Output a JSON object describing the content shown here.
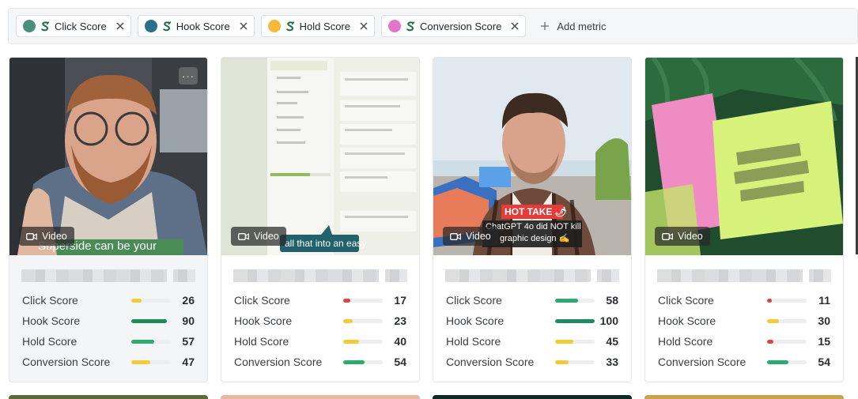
{
  "filters": {
    "chips": [
      {
        "label": "Click Score",
        "color": "#4a8f7a"
      },
      {
        "label": "Hook Score",
        "color": "#2a6f8c"
      },
      {
        "label": "Hold Score",
        "color": "#f5b93b"
      },
      {
        "label": "Conversion Score",
        "color": "#e276c9"
      }
    ],
    "add_label": "Add metric"
  },
  "metric_labels": [
    "Click Score",
    "Hook Score",
    "Hold Score",
    "Conversion Score"
  ],
  "cards": [
    {
      "badge": "Video",
      "caption": "Superside can be your",
      "metrics": [
        {
          "value": 26,
          "color": "#f2cc37"
        },
        {
          "value": 90,
          "color": "#1f8a5c"
        },
        {
          "value": 57,
          "color": "#2faa6e"
        },
        {
          "value": 47,
          "color": "#f2cc37"
        }
      ]
    },
    {
      "badge": "Video",
      "caption": "all that into an easy",
      "metrics": [
        {
          "value": 17,
          "color": "#d9463b"
        },
        {
          "value": 23,
          "color": "#f2cc37"
        },
        {
          "value": 40,
          "color": "#f2cc37"
        },
        {
          "value": 54,
          "color": "#2faa6e"
        }
      ]
    },
    {
      "badge": "Video",
      "caption_tag": "HOT TAKE 🌶",
      "caption_line1": "ChatGPT 4o did NOT kill",
      "caption_line2": "graphic design ✍",
      "metrics": [
        {
          "value": 58,
          "color": "#2faa6e"
        },
        {
          "value": 100,
          "color": "#1f8a5c"
        },
        {
          "value": 45,
          "color": "#f2cc37"
        },
        {
          "value": 33,
          "color": "#f2cc37"
        }
      ]
    },
    {
      "badge": "Video",
      "metrics": [
        {
          "value": 11,
          "color": "#d9463b"
        },
        {
          "value": 30,
          "color": "#f2cc37"
        },
        {
          "value": 15,
          "color": "#d9463b"
        },
        {
          "value": 54,
          "color": "#2faa6e"
        }
      ]
    }
  ]
}
